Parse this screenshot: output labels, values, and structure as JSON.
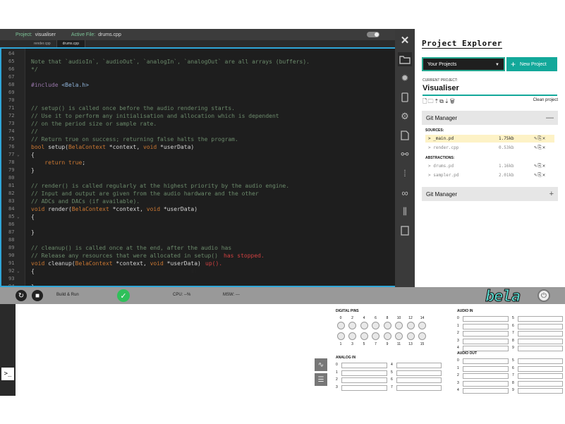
{
  "topbar": {
    "project_label": "Project:",
    "project_name": "visualiser",
    "file_label": "Active File:",
    "file_name": "drums.cpp"
  },
  "tabs": [
    {
      "label": "render.cpp"
    },
    {
      "label": "drums.cpp"
    }
  ],
  "editor": {
    "lines": [
      {
        "n": "64",
        "fold": "",
        "text": ""
      },
      {
        "n": "65",
        "fold": "",
        "text": "Note that `audioIn`, `audioOut`, `analogIn`, `analogOut` are all arrays (buffers)."
      },
      {
        "n": "66",
        "fold": "",
        "text": "*/"
      },
      {
        "n": "67",
        "fold": "",
        "text": ""
      },
      {
        "n": "68",
        "fold": "",
        "text": "#include <Bela.h>"
      },
      {
        "n": "69",
        "fold": "",
        "text": ""
      },
      {
        "n": "70",
        "fold": "",
        "text": ""
      },
      {
        "n": "71",
        "fold": "",
        "text": "// setup() is called once before the audio rendering starts."
      },
      {
        "n": "72",
        "fold": "",
        "text": "// Use it to perform any initialisation and allocation which is dependent"
      },
      {
        "n": "73",
        "fold": "",
        "text": "// on the period size or sample rate."
      },
      {
        "n": "74",
        "fold": "",
        "text": "//"
      },
      {
        "n": "75",
        "fold": "",
        "text": "// Return true on success; returning false halts the program."
      },
      {
        "n": "76",
        "fold": "",
        "text": "bool setup(BelaContext *context, void *userData)"
      },
      {
        "n": "77",
        "fold": "⌄",
        "text": "{"
      },
      {
        "n": "78",
        "fold": "",
        "text": "    return true;"
      },
      {
        "n": "79",
        "fold": "",
        "text": "}"
      },
      {
        "n": "80",
        "fold": "",
        "text": ""
      },
      {
        "n": "81",
        "fold": "",
        "text": "// render() is called regularly at the highest priority by the audio engine."
      },
      {
        "n": "82",
        "fold": "",
        "text": "// Input and output are given from the audio hardware and the other"
      },
      {
        "n": "83",
        "fold": "",
        "text": "// ADCs and DACs (if available)."
      },
      {
        "n": "84",
        "fold": "",
        "text": "void render(BelaContext *context, void *userData)"
      },
      {
        "n": "85",
        "fold": "⌄",
        "text": "{"
      },
      {
        "n": "86",
        "fold": "",
        "text": ""
      },
      {
        "n": "87",
        "fold": "",
        "text": "}"
      },
      {
        "n": "88",
        "fold": "",
        "text": ""
      },
      {
        "n": "89",
        "fold": "",
        "text": "// cleanup() is called once at the end, after the audio has"
      },
      {
        "n": "90",
        "fold": "",
        "text": "// Release any resources that were allocated in setup()"
      },
      {
        "n": "91",
        "fold": "",
        "text": "void cleanup(BelaContext *context, void *userData)"
      },
      {
        "n": "92",
        "fold": "⌄",
        "text": "{"
      },
      {
        "n": "93",
        "fold": "",
        "text": ""
      },
      {
        "n": "94",
        "fold": "",
        "text": "}"
      }
    ],
    "fragment_90": "has stopped.",
    "fragment_91": "up().",
    "fragment_92": "a)"
  },
  "explorer": {
    "title": "Project Explorer",
    "project_select": "Your Projects",
    "new_project": "New Project",
    "current_label": "CURRENT PROJECT:",
    "current_name": "Visualiser",
    "clean_label": "Clean project",
    "files_header": "Git Manager",
    "sources_label": "SOURCES:",
    "sources": [
      {
        "name": "> _main.pd",
        "size": "1.75kb",
        "selected": true
      },
      {
        "name": "> render.cpp",
        "size": "0.53kb",
        "selected": false
      }
    ],
    "abstractions_label": "ABSTRACTIONS:",
    "abstractions": [
      {
        "name": "> drums.pd",
        "size": "1.16kb"
      },
      {
        "name": "> sampler.pd",
        "size": "2.01kb"
      }
    ],
    "git_header": "Git Manager"
  },
  "toolbar": {
    "build_label": "Build & Run",
    "cpu_label": "CPU: --%",
    "msw_label": "MSW: ---",
    "logo_text": "bela"
  },
  "pins": {
    "digital_title": "DIGITAL PINS",
    "top_numbers": [
      "0",
      "2",
      "4",
      "6",
      "8",
      "10",
      "12",
      "14"
    ],
    "bottom_numbers": [
      "1",
      "3",
      "5",
      "7",
      "9",
      "11",
      "13",
      "15"
    ],
    "analog_in_title": "ANALOG IN",
    "analog_in_left": [
      "0",
      "1",
      "2",
      "3"
    ],
    "analog_in_right": [
      "4",
      "5",
      "6",
      "7"
    ],
    "audio_in_title": "AUDIO IN",
    "audio_in_left": [
      "0",
      "1",
      "2",
      "3",
      "4"
    ],
    "audio_in_right": [
      "5",
      "6",
      "7",
      "8",
      "9"
    ],
    "audio_out_title": "AUDIO OUT",
    "audio_out_left": [
      "0",
      "1",
      "2",
      "3",
      "4"
    ],
    "audio_out_right": [
      "5",
      "6",
      "7",
      "8",
      "9"
    ]
  },
  "colors": {
    "accent": "#13a89a",
    "editor_border": "#2fa6d8",
    "build_ok": "#2fc05a",
    "selected_row": "#fdf2c6"
  }
}
